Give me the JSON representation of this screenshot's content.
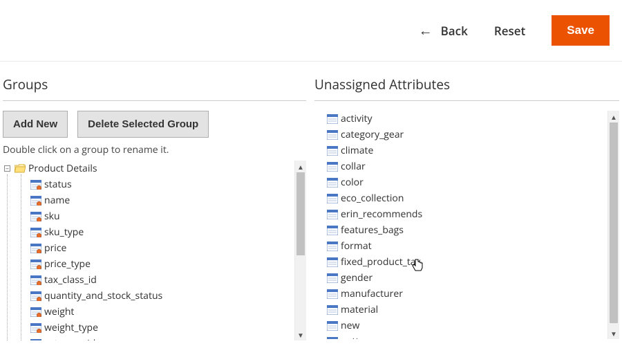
{
  "topbar": {
    "back_label": "Back",
    "reset_label": "Reset",
    "save_label": "Save"
  },
  "groups": {
    "title": "Groups",
    "add_new_label": "Add New",
    "delete_label": "Delete Selected Group",
    "hint": "Double click on a group to rename it.",
    "root": "Product Details",
    "items": [
      "status",
      "name",
      "sku",
      "sku_type",
      "price",
      "price_type",
      "tax_class_id",
      "quantity_and_stock_status",
      "weight",
      "weight_type",
      "category_ids"
    ]
  },
  "unassigned": {
    "title": "Unassigned Attributes",
    "items": [
      "activity",
      "category_gear",
      "climate",
      "collar",
      "color",
      "eco_collection",
      "erin_recommends",
      "features_bags",
      "format",
      "fixed_product_tax",
      "gender",
      "manufacturer",
      "material",
      "new",
      "pattern"
    ]
  }
}
